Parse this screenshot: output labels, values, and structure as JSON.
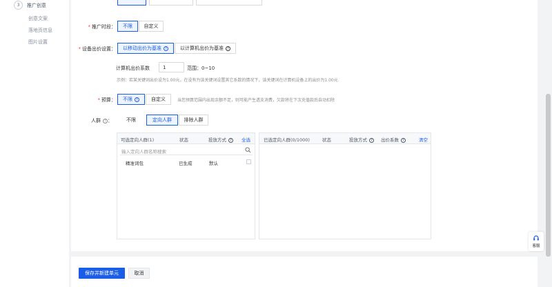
{
  "sidebar": {
    "step_number": "3",
    "step_label": "推广创意",
    "sub_items": [
      "创意文案",
      "落地页信息",
      "图片设置"
    ]
  },
  "schedule": {
    "label": "推广时段：",
    "options": [
      "不限",
      "自定义"
    ]
  },
  "device_bid": {
    "label": "设备出价设置：",
    "mobile_option": "以移动出价为基准",
    "pc_option": "以计算机出价为基准",
    "coef_label": "计算机出价系数",
    "coef_value": "1",
    "range": "范围：0~10",
    "example": "示例：若某关键词出价设为1.00元，在没有为该关键词设置其它系数的情况下，该关键词在计算机设备上的出价为1.00元"
  },
  "budget": {
    "label": "预算：",
    "option_unlimited": "不限",
    "option_custom": "自定义",
    "hint": "当您预算范围内出现余额不足，则可能产生透支消费，欠款将在下次充值款后自动扣除"
  },
  "crowd": {
    "label": "人群",
    "options": [
      "不限",
      "定向人群",
      "排除人群"
    ]
  },
  "left_panel": {
    "title": "可选定向人群(1)",
    "col_status": "状态",
    "col_method": "投放方式",
    "select_all": "全选",
    "search_placeholder": "输入定向人群名称搜索",
    "rows": [
      {
        "name": "精准词包",
        "status": "已生成",
        "method": "默认"
      }
    ]
  },
  "right_panel": {
    "title": "已选定向人群(0/1000)",
    "col_status": "状态",
    "col_method": "投放方式",
    "col_coef": "出价系数",
    "clear": "清空"
  },
  "footer": {
    "save_label": "保存并新建单元",
    "cancel_label": "取消"
  },
  "help_widget": {
    "label": "客服"
  },
  "colors": {
    "primary": "#1a5ee8",
    "required": "#f53f3f"
  }
}
